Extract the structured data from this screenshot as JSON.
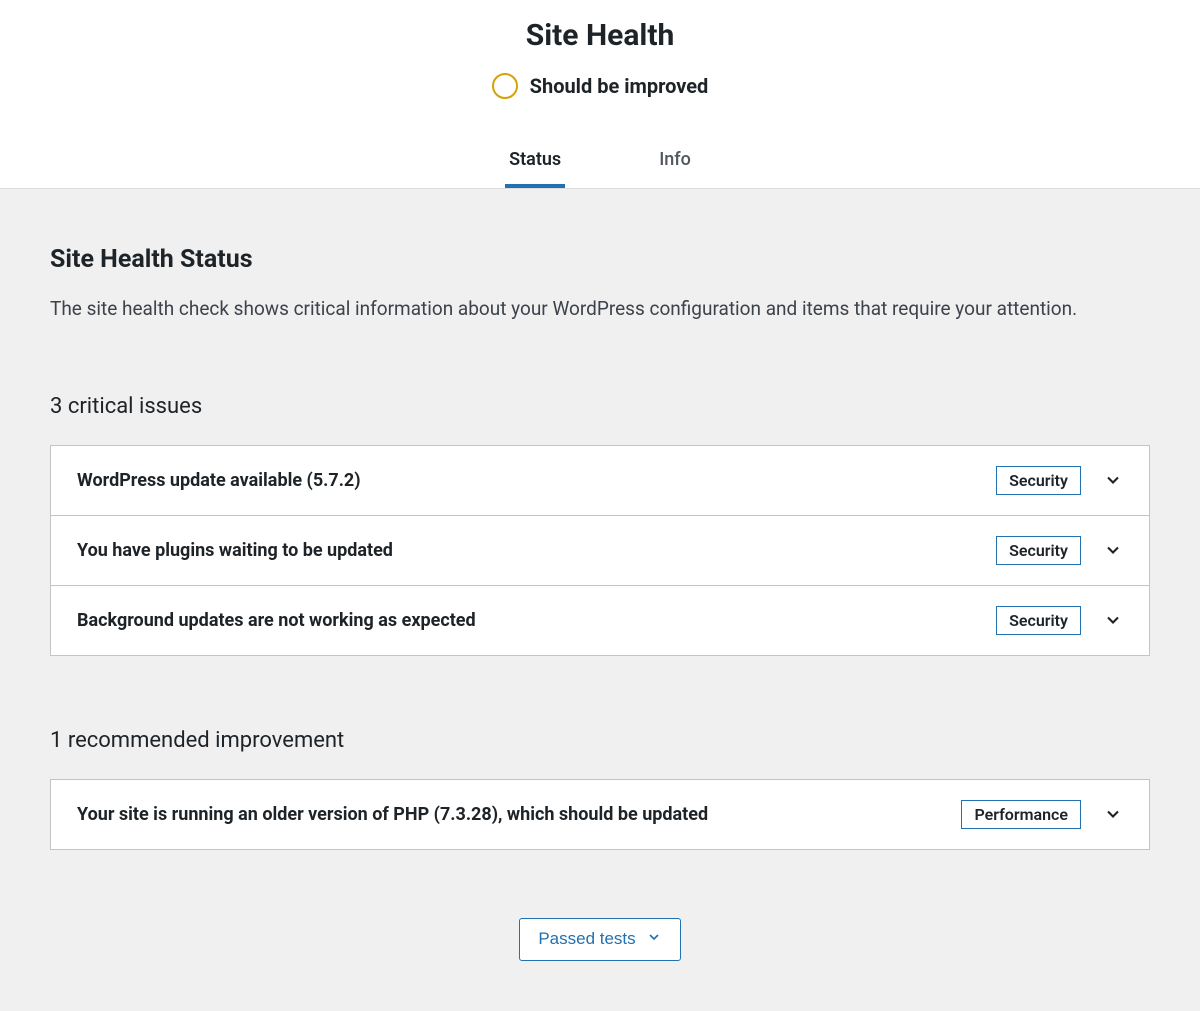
{
  "header": {
    "title": "Site Health",
    "status_circle_color": "#d6a106",
    "status_label": "Should be improved"
  },
  "tabs": [
    {
      "label": "Status",
      "active": true
    },
    {
      "label": "Info",
      "active": false
    }
  ],
  "section": {
    "heading": "Site Health Status",
    "description": "The site health check shows critical information about your WordPress configuration and items that require your attention."
  },
  "critical": {
    "heading": "3 critical issues",
    "items": [
      {
        "title": "WordPress update available (5.7.2)",
        "badge": "Security"
      },
      {
        "title": "You have plugins waiting to be updated",
        "badge": "Security"
      },
      {
        "title": "Background updates are not working as expected",
        "badge": "Security"
      }
    ]
  },
  "recommended": {
    "heading": "1 recommended improvement",
    "items": [
      {
        "title": "Your site is running an older version of PHP (7.3.28), which should be updated",
        "badge": "Performance"
      }
    ]
  },
  "passed_button": {
    "label": "Passed tests"
  }
}
